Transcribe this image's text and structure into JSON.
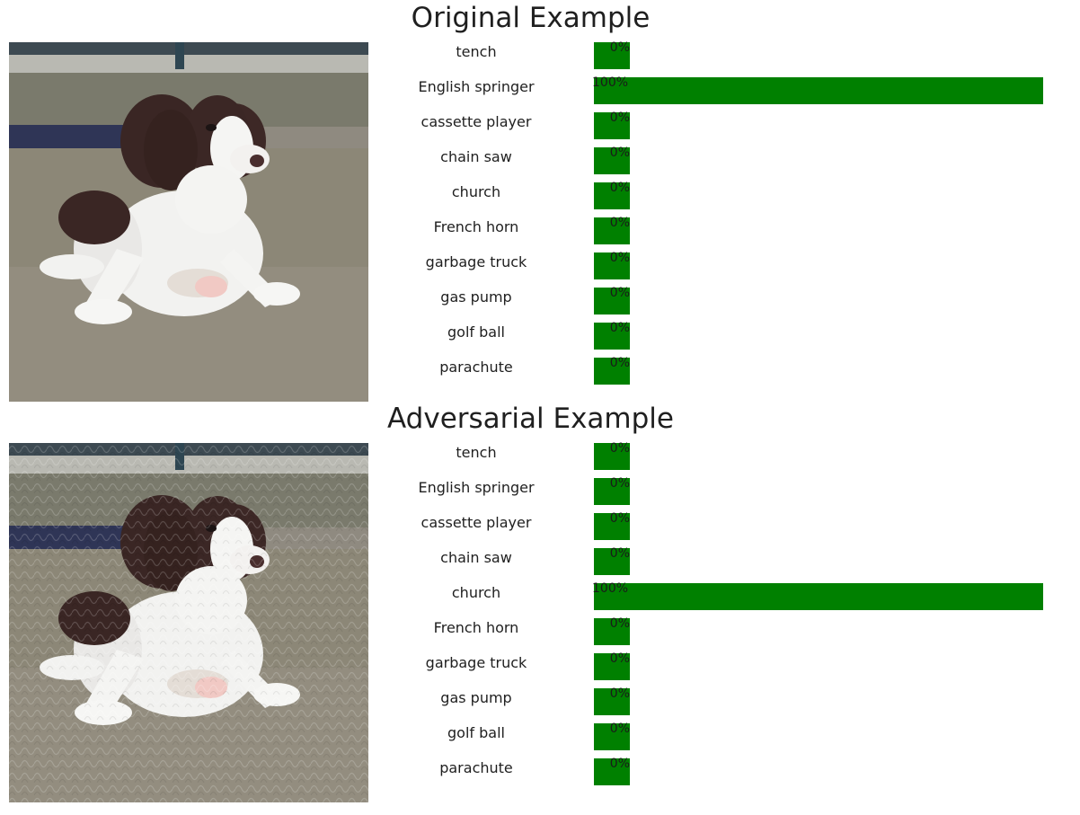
{
  "sections": [
    {
      "title": "Original Example",
      "image_icon": "puppy-photo",
      "predictions": [
        {
          "label": "tench",
          "percent_text": "0%",
          "value": 0
        },
        {
          "label": "English springer",
          "percent_text": "100%",
          "value": 100
        },
        {
          "label": "cassette player",
          "percent_text": "0%",
          "value": 0
        },
        {
          "label": "chain saw",
          "percent_text": "0%",
          "value": 0
        },
        {
          "label": "church",
          "percent_text": "0%",
          "value": 0
        },
        {
          "label": "French horn",
          "percent_text": "0%",
          "value": 0
        },
        {
          "label": "garbage truck",
          "percent_text": "0%",
          "value": 0
        },
        {
          "label": "gas pump",
          "percent_text": "0%",
          "value": 0
        },
        {
          "label": "golf ball",
          "percent_text": "0%",
          "value": 0
        },
        {
          "label": "parachute",
          "percent_text": "0%",
          "value": 0
        }
      ]
    },
    {
      "title": "Adversarial Example",
      "image_icon": "puppy-photo-adversarial",
      "predictions": [
        {
          "label": "tench",
          "percent_text": "0%",
          "value": 0
        },
        {
          "label": "English springer",
          "percent_text": "0%",
          "value": 0
        },
        {
          "label": "cassette player",
          "percent_text": "0%",
          "value": 0
        },
        {
          "label": "chain saw",
          "percent_text": "0%",
          "value": 0
        },
        {
          "label": "church",
          "percent_text": "100%",
          "value": 100
        },
        {
          "label": "French horn",
          "percent_text": "0%",
          "value": 0
        },
        {
          "label": "garbage truck",
          "percent_text": "0%",
          "value": 0
        },
        {
          "label": "gas pump",
          "percent_text": "0%",
          "value": 0
        },
        {
          "label": "golf ball",
          "percent_text": "0%",
          "value": 0
        },
        {
          "label": "parachute",
          "percent_text": "0%",
          "value": 0
        }
      ]
    }
  ],
  "colors": {
    "bar": "#008000",
    "text": "#1f1f1f"
  }
}
